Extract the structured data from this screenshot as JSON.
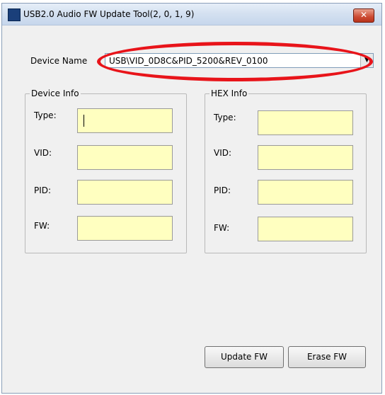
{
  "window": {
    "title": "USB2.0 Audio FW Update Tool(2, 0, 1, 9)",
    "close_label": "✕"
  },
  "device": {
    "label": "Device Name",
    "value": "USB\\VID_0D8C&PID_5200&REV_0100",
    "dropdown_arrow": "▼"
  },
  "device_info": {
    "title": "Device Info",
    "fields": [
      {
        "label": "Type:",
        "value": ""
      },
      {
        "label": "VID:",
        "value": ""
      },
      {
        "label": "PID:",
        "value": ""
      },
      {
        "label": "FW:",
        "value": ""
      }
    ]
  },
  "hex_info": {
    "title": "HEX Info",
    "fields": [
      {
        "label": "Type:",
        "value": ""
      },
      {
        "label": "VID:",
        "value": ""
      },
      {
        "label": "PID:",
        "value": ""
      },
      {
        "label": "FW:",
        "value": ""
      }
    ]
  },
  "buttons": {
    "update": "Update FW",
    "erase": "Erase FW"
  },
  "colors": {
    "field_background": "#ffffc0",
    "annotation_ring": "#e8141a"
  },
  "icons": {
    "app": "app-icon",
    "close": "close-icon",
    "dropdown": "chevron-down-icon"
  }
}
